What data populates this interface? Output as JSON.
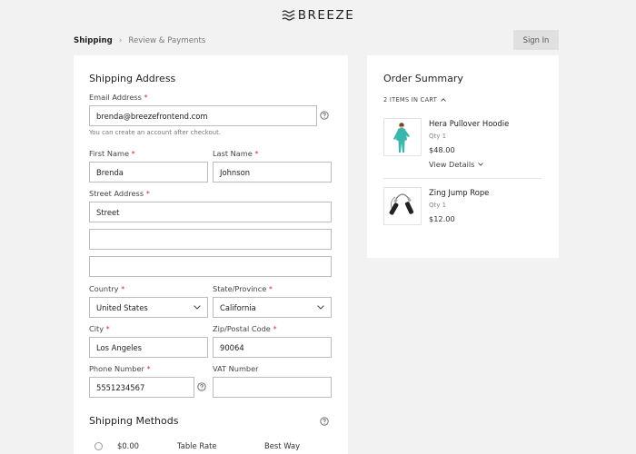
{
  "brand": {
    "name": "BREEZE"
  },
  "breadcrumb": {
    "current": "Shipping",
    "separator": "›",
    "next": "Review & Payments"
  },
  "header": {
    "signin_label": "Sign In"
  },
  "shipping_address": {
    "title": "Shipping Address",
    "email": {
      "label": "Email Address",
      "value": "brenda@breezefrontend.com",
      "hint": "You can create an account after checkout."
    },
    "first_name": {
      "label": "First Name",
      "value": "Brenda"
    },
    "last_name": {
      "label": "Last Name",
      "value": "Johnson"
    },
    "street": {
      "label": "Street Address",
      "line1": "Street",
      "line2": "",
      "line3": ""
    },
    "country": {
      "label": "Country",
      "value": "United States"
    },
    "region": {
      "label": "State/Province",
      "value": "California"
    },
    "city": {
      "label": "City",
      "value": "Los Angeles"
    },
    "postcode": {
      "label": "Zip/Postal Code",
      "value": "90064"
    },
    "phone": {
      "label": "Phone Number",
      "value": "5551234567"
    },
    "vat": {
      "label": "VAT Number",
      "value": ""
    },
    "required_mark": "*"
  },
  "shipping_methods": {
    "title": "Shipping Methods",
    "options": [
      {
        "price": "$0.00",
        "method": "Table Rate",
        "carrier": "Best Way"
      }
    ]
  },
  "order_summary": {
    "title": "Order Summary",
    "items_toggle": "2 ITEMS IN CART",
    "items": [
      {
        "name": "Hera Pullover Hoodie",
        "qty": "Qty 1",
        "price": "$48.00",
        "details_label": "View Details"
      },
      {
        "name": "Zing Jump Rope",
        "qty": "Qty 1",
        "price": "$12.00"
      }
    ]
  },
  "colors": {
    "background": "#f2f2f2",
    "panel": "#ffffff",
    "required": "#d32f2f",
    "hoodie": "#3bb6ad"
  }
}
